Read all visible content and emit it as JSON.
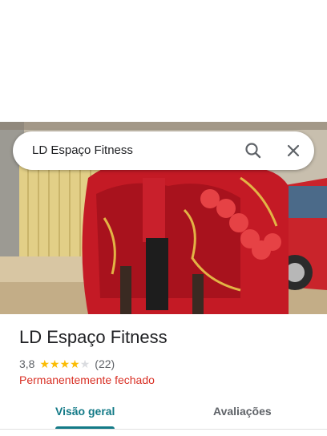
{
  "search": {
    "query": "LD Espaço Fitness"
  },
  "place": {
    "name": "LD Espaço Fitness",
    "rating": "3,8",
    "rating_value": 3.8,
    "stars_max": 5,
    "review_count": "(22)",
    "status": "Permanentemente fechado"
  },
  "tabs": [
    {
      "label": "Visão geral",
      "active": true
    },
    {
      "label": "Avaliações",
      "active": false
    }
  ],
  "colors": {
    "status_red": "#d93025",
    "active_tab": "#137a87",
    "star_gold": "#fbbc04",
    "star_empty": "#dadce0"
  },
  "icons": [
    "search-icon",
    "close-icon"
  ]
}
